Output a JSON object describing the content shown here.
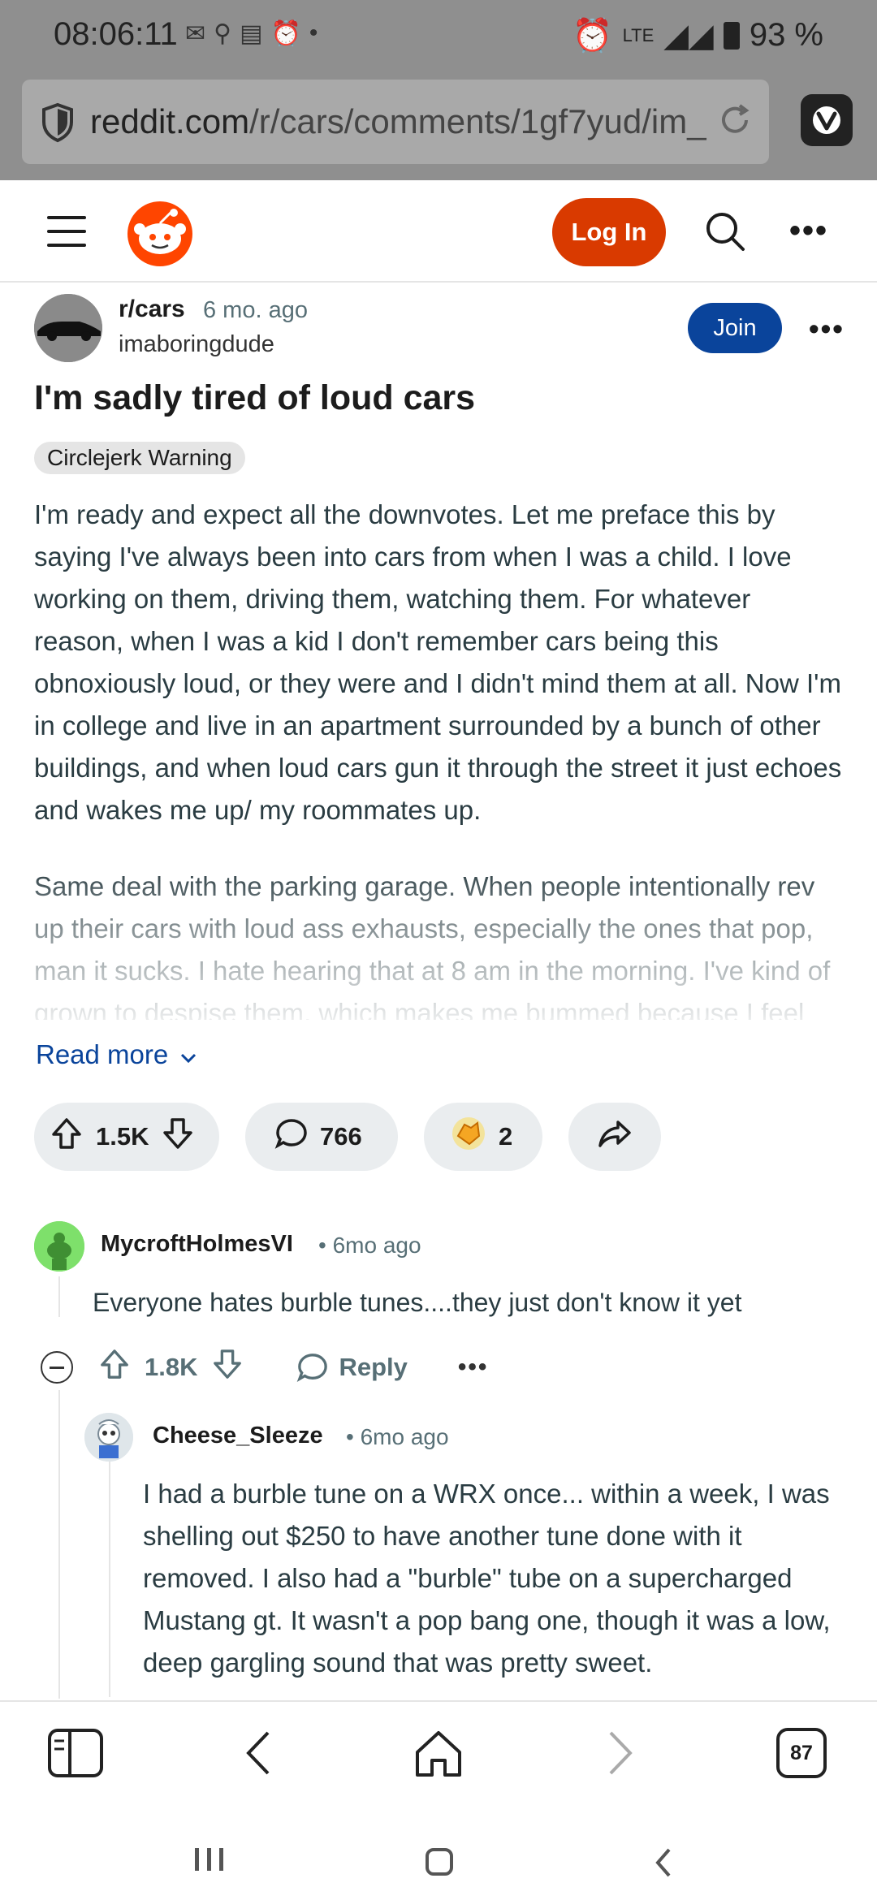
{
  "status_bar": {
    "time": "08:06:11",
    "network": "LTE",
    "battery": "93 %"
  },
  "browser": {
    "url_domain": "reddit.com",
    "url_path": "/r/cars/comments/1gf7yud/im_",
    "tab_count": "87"
  },
  "header": {
    "login_label": "Log In"
  },
  "post": {
    "subreddit": "r/cars",
    "time": "6 mo. ago",
    "author": "imaboringdude",
    "join_label": "Join",
    "title": "I'm sadly tired of loud cars",
    "flair": "Circlejerk Warning",
    "paragraph1": "I'm ready and expect all the downvotes. Let me preface this by saying I've always been into cars from when I was a child. I love working on them, driving them, watching them. For whatever reason, when I was a kid I don't remember cars being this obnoxiously loud, or they were and I didn't mind them at all. Now I'm in college and live in an apartment surrounded by a bunch of other buildings, and when loud cars gun it through the street it just echoes and wakes me up/ my roommates up.",
    "paragraph2": "Same deal with the parking garage. When people intentionally rev up their cars with loud ass exhausts, especially the ones that pop, man it sucks. I hate hearing that at 8 am in the morning. I've kind of grown to despise them, which makes me bummed because I feel",
    "read_more": "Read more",
    "votes": "1.5K",
    "comments": "766",
    "awards": "2"
  },
  "comments": [
    {
      "author": "MycroftHolmesVI",
      "time": "6mo ago",
      "text": "Everyone hates burble tunes....they just don't know it yet",
      "score": "1.8K",
      "reply_label": "Reply"
    },
    {
      "author": "Cheese_Sleeze",
      "time": "6mo ago",
      "text": "I had a burble tune on a WRX once... within a week, I was shelling out $250 to have another tune done with it removed. I also had a \"burble\" tube on a supercharged Mustang gt. It wasn't a pop bang one, though it was a low, deep gargling sound that was pretty sweet."
    }
  ],
  "colors": {
    "reddit_orange": "#d93a00",
    "join_blue": "#0a449b",
    "pill_gray": "#eaedef",
    "meta_gray": "#576f76"
  }
}
